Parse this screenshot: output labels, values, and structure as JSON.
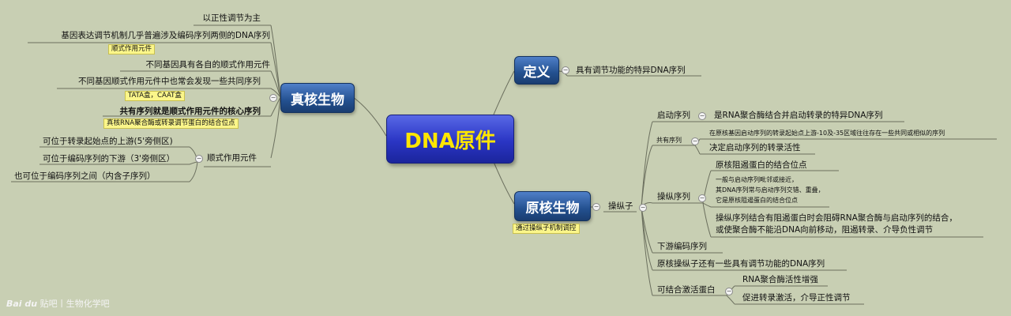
{
  "central": "DNA原件",
  "left_branch": {
    "title": "真核生物",
    "items": [
      "以正性调节为主",
      "基因表达调节机制几乎普遍涉及编码序列两侧的DNA序列",
      "不同基因具有各自的顺式作用元件",
      "不同基因顺式作用元件中也常会发现一些共同序列",
      "共有序列就是顺式作用元件的核心序列"
    ],
    "notes": [
      "顺式作用元件",
      "TATA盒，CAAT盒",
      "真核RNA聚合酶或转录调节蛋白的结合位点"
    ],
    "cis_element": {
      "label": "顺式作用元件",
      "children": [
        "可位于转录起始点的上游(5'旁侧区)",
        "可位于编码序列的下游（3'旁侧区）",
        "也可位于编码序列之间（内含子序列）"
      ]
    }
  },
  "definition": {
    "title": "定义",
    "text": "具有调节功能的特异DNA序列"
  },
  "right_branch": {
    "title": "原核生物",
    "note": "通过操纵子机制调控",
    "operon": {
      "label": "操纵子",
      "promoter": {
        "label": "启动序列",
        "text": "是RNA聚合酶结合并启动转录的特异DNA序列"
      },
      "consensus": {
        "label": "共有序列",
        "text1": "在原核基因启动序列的转录起始点上游-10及-35区域往往存在一些共同或相似的序列",
        "text2": "决定启动序列的转录活性"
      },
      "operator": {
        "label": "操纵序列",
        "text1": "原核阻遏蛋白的结合位点",
        "text2_lines": [
          "一般与启动序列毗邻或接近，",
          "其DNA序列常与启动序列交错、重叠，",
          "它是原核阻遏蛋白的结合位点"
        ],
        "text3_lines": [
          "操纵序列结合有阻遏蛋白时会阻碍RNA聚合酶与启动序列的结合，",
          "或使聚合酶不能沿DNA向前移动，阻遏转录、介导负性调节"
        ]
      },
      "downstream": "下游编码序列"
    },
    "other": "原核操纵子还有一些具有调节功能的DNA序列",
    "activator": {
      "label": "可结合激活蛋白",
      "children": [
        "RNA聚合酶活性增强",
        "促进转录激活，介导正性调节"
      ]
    }
  },
  "watermark": {
    "logo": "Bai du",
    "text": "贴吧丨生物化学吧"
  }
}
